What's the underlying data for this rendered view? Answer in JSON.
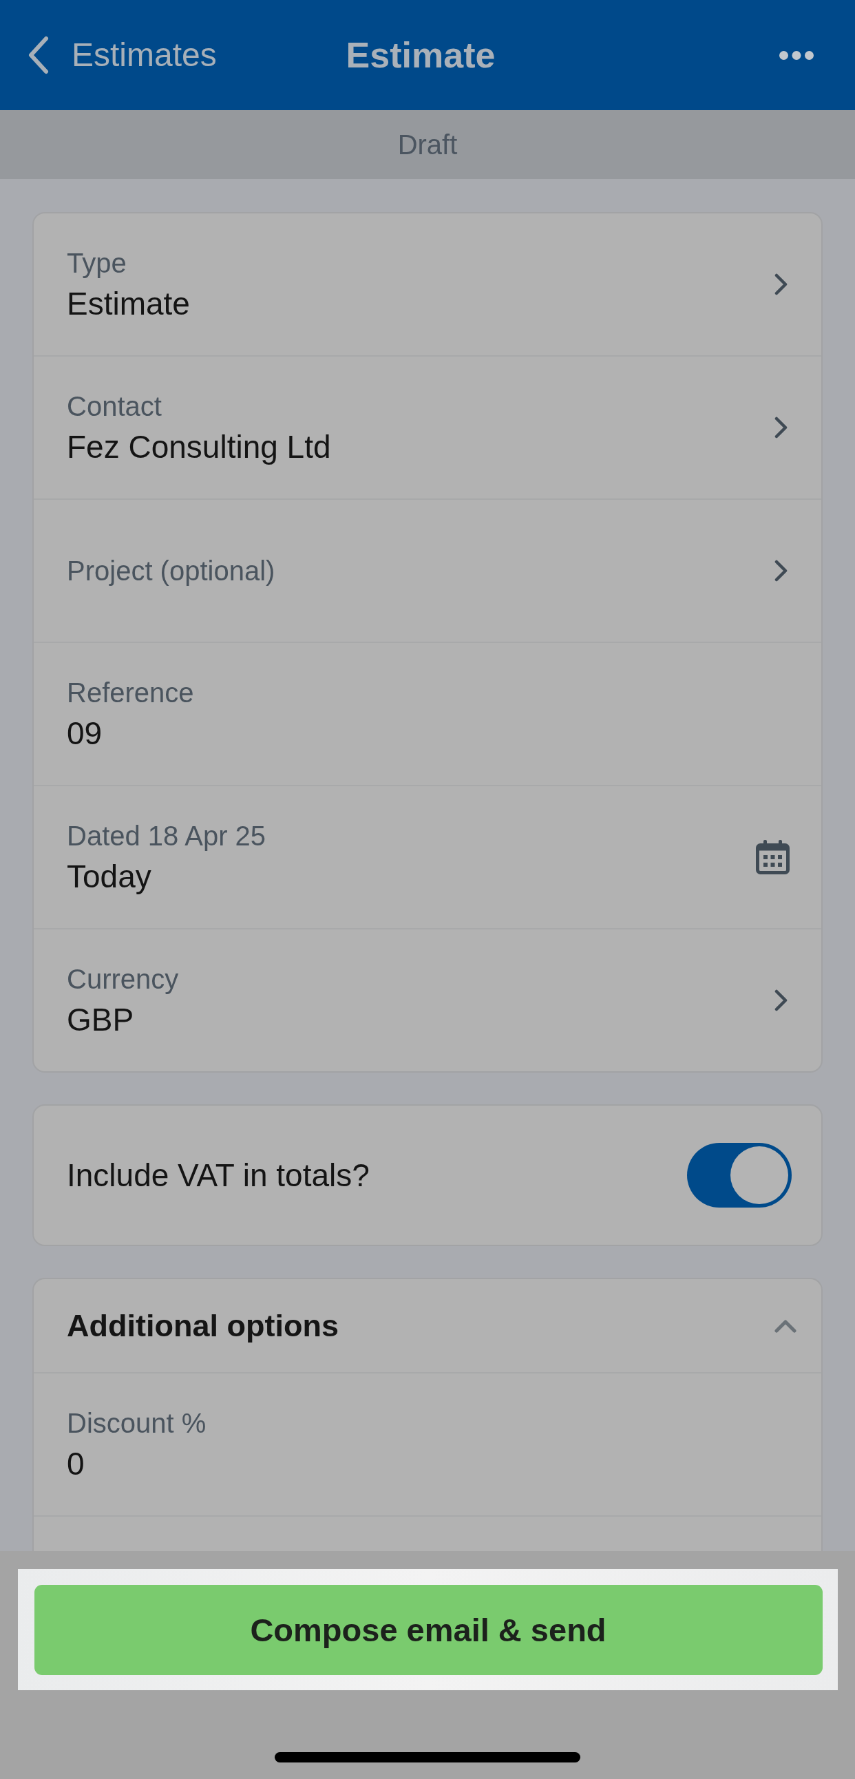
{
  "header": {
    "back_label": "Estimates",
    "title": "Estimate"
  },
  "status": "Draft",
  "fields": [
    {
      "kind": "select",
      "label": "Type",
      "value": "Estimate"
    },
    {
      "kind": "select",
      "label": "Contact",
      "value": "Fez Consulting Ltd"
    },
    {
      "kind": "select",
      "label": "Project (optional)"
    },
    {
      "kind": "text",
      "label": "Reference",
      "value": "09"
    },
    {
      "kind": "date",
      "label": "Dated 18 Apr 25",
      "value": "Today"
    },
    {
      "kind": "select",
      "label": "Currency",
      "value": "GBP"
    }
  ],
  "vat_toggle": {
    "label": "Include VAT in totals?",
    "on": true
  },
  "additional_options": {
    "title": "Additional options",
    "expanded": true,
    "fields": [
      {
        "label": "Discount %",
        "value": "0"
      }
    ]
  },
  "primary_button": {
    "label": "Compose email & send"
  }
}
